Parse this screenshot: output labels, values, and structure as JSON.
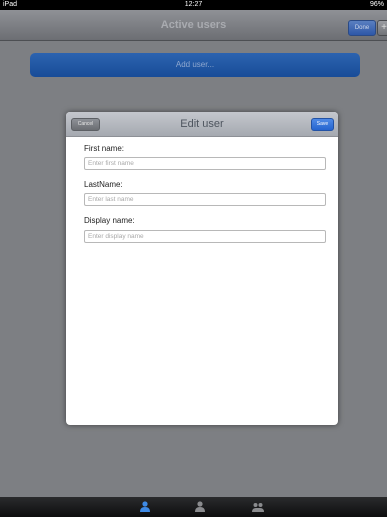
{
  "status_bar": {
    "carrier": "iPad",
    "time": "12:27",
    "battery": "96%"
  },
  "nav_bar": {
    "title": "Active users",
    "done_label": "Done",
    "add_label": "+"
  },
  "main": {
    "add_user_label": "Add user..."
  },
  "modal": {
    "title": "Edit user",
    "cancel_label": "Cancel",
    "save_label": "Save",
    "fields": [
      {
        "label": "First name:",
        "placeholder": "Enter first name",
        "value": ""
      },
      {
        "label": "LastName:",
        "placeholder": "Enter last name",
        "value": ""
      },
      {
        "label": "Display name:",
        "placeholder": "Enter display name",
        "value": ""
      }
    ]
  },
  "tab_bar": {
    "items": [
      {
        "icon": "user-icon",
        "active": true
      },
      {
        "icon": "user-icon",
        "active": false
      },
      {
        "icon": "group-icon",
        "active": false
      }
    ]
  },
  "colors": {
    "accent": "#2564cf",
    "backdrop": "#7d7f83"
  }
}
